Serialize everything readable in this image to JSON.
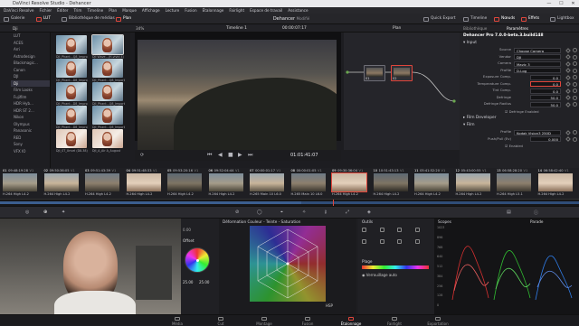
{
  "window": {
    "title": "DaVinci Resolve Studio - Dehancer",
    "controls": [
      "—",
      "☐",
      "✕"
    ]
  },
  "menu": [
    "DaVinci Resolve",
    "Fichier",
    "Éditer",
    "Trim",
    "Timeline",
    "Plan",
    "Marque",
    "Affichage",
    "Lecture",
    "Fusion",
    "Étalonnage",
    "Fairlight",
    "Espace de travail",
    "Assistance"
  ],
  "toolbar": {
    "left": [
      {
        "label": "Galerie",
        "icon": "gallery-icon"
      },
      {
        "label": "LUT",
        "icon": "lut-icon"
      },
      {
        "label": "Bibliothèque de médias",
        "icon": "media-library-icon"
      },
      {
        "label": "Plan",
        "icon": "clip-icon"
      }
    ],
    "project": "Dehancer",
    "project_status": "Modifié",
    "right": [
      {
        "label": "Quick Export",
        "icon": "export-icon"
      },
      {
        "label": "Timeline",
        "icon": "timeline-icon"
      },
      {
        "label": "Nœuds",
        "icon": "nodes-icon"
      },
      {
        "label": "Effets",
        "icon": "effects-icon"
      },
      {
        "label": "Lightbox",
        "icon": "lightbox-icon"
      }
    ]
  },
  "subbar": {
    "zoom": "34%",
    "timeline": "Timeline 1",
    "timecode": "00:00:07:17",
    "clip_label": "Plan",
    "insp_tab1": "Bibliothèque",
    "insp_tab2": "Paramètres"
  },
  "media_tree": {
    "header": "Dji",
    "items": [
      "LUT",
      "ACES",
      "Arri",
      "Astrodesign",
      "Blackmagic...",
      "Canon",
      "DJI",
      "Dji",
      "Film Looks",
      "Fujifilm",
      "HDR Hyb...",
      "HDR ST 2...",
      "Nikon",
      "Olympus",
      "Panasonic",
      "RED",
      "Sony",
      "VFX IO"
    ],
    "selected_index": 7
  },
  "lut_thumbs": [
    {
      "caption": "DJI_Phant...Q8_Impro"
    },
    {
      "caption": "DJI Wave...(H-vivid 4)"
    },
    {
      "caption": "DJI_Phant...D8_Impro"
    },
    {
      "caption": "DJI_Phant...Q8_Import"
    },
    {
      "caption": "DJI_Phant...D8_Impro"
    },
    {
      "caption": "DJI_Phant...Q8_Import"
    },
    {
      "caption": "DJI_Phant...D8_Impro"
    },
    {
      "caption": "DJI_Phant...Q8_Import"
    },
    {
      "caption": "DJI_ST_Unvel (D8.38)"
    },
    {
      "caption": "DJI_A_Air A_August"
    }
  ],
  "viewer": {
    "timecode": "01:01:41:07"
  },
  "node_graph": {
    "nodes": [
      {
        "label": "01"
      },
      {
        "label": "02"
      }
    ]
  },
  "inspector": {
    "plugin_title": "Dehancer Pro 7.0.0-beta.3.build148",
    "section_input": "Input",
    "rows": [
      {
        "label": "Source",
        "value": "Choose Camera"
      },
      {
        "label": "Vendor",
        "value": "DJI"
      },
      {
        "label": "Camera",
        "value": "Mavic 3"
      },
      {
        "label": "Profile",
        "value": "D-Log"
      },
      {
        "label": "Exposure Comp.",
        "value": "0.0"
      },
      {
        "label": "Temperature Comp.",
        "value": "0.0"
      },
      {
        "label": "Tint Comp.",
        "value": "0.0"
      },
      {
        "label": "Defringe",
        "value": "50.0"
      },
      {
        "label": "Defringe Radius",
        "value": "50.0"
      }
    ],
    "checkbox_defringe": "Defringe Enabled",
    "section_film_dev": "Film Developer",
    "section_film": "Film",
    "film_rows": [
      {
        "label": "Profile",
        "value": "Kodak Vision3 250D"
      },
      {
        "label": "Push/Pull (Ev)",
        "value": "0.000"
      }
    ],
    "enabled_label": "Enabled"
  },
  "clips": [
    {
      "num": "01",
      "tc": "09:48:19:28",
      "track": "V1",
      "caption": "H.264 High L4.2"
    },
    {
      "num": "02",
      "tc": "09:50:36:05",
      "track": "V1",
      "caption": "H.264 High L4.2"
    },
    {
      "num": "03",
      "tc": "09:51:43:39",
      "track": "V1",
      "caption": "H.264 High L4.2"
    },
    {
      "num": "04",
      "tc": "09:51:48:33",
      "track": "V1",
      "caption": "H.264 High L4.2"
    },
    {
      "num": "05",
      "tc": "09:53:20:16",
      "track": "V1",
      "caption": "H.264 High L4.2"
    },
    {
      "num": "06",
      "tc": "09:52:04:44",
      "track": "V1",
      "caption": "H.264 High L4.2"
    },
    {
      "num": "07",
      "tc": "00:00:01:17",
      "track": "V1",
      "caption": "H.265 Main 10 L6.0"
    },
    {
      "num": "08",
      "tc": "00:00:01:05",
      "track": "V1",
      "caption": "H.265 Main 10 L6.0"
    },
    {
      "num": "09",
      "tc": "09:30:36:04",
      "track": "V1",
      "caption": "H.264 High L4.2"
    },
    {
      "num": "10",
      "tc": "10:51:43:13",
      "track": "V1",
      "caption": "H.264 High L4.2"
    },
    {
      "num": "11",
      "tc": "05:41:52:20",
      "track": "V1",
      "caption": "H.264 High L4.2"
    },
    {
      "num": "12",
      "tc": "05:43:00:55",
      "track": "V1",
      "caption": "H.264 High L4.2"
    },
    {
      "num": "13",
      "tc": "06:58:28:20",
      "track": "V1",
      "caption": "H.264 High L5.1"
    },
    {
      "num": "14",
      "tc": "06:58:42:40",
      "track": "V1",
      "caption": "H.264 High L4.2"
    }
  ],
  "bottom": {
    "offset_label": "Offset",
    "offset_val1": "25.00",
    "offset_val2": "25.00",
    "zero_val": "0.00",
    "warp_title": "Déformation Couleur - Teinte - Saturation",
    "hsp_label": "HSP",
    "tools_title": "Outils",
    "range_title": "Plage",
    "lock_label": "Verrouillage auto",
    "scopes_title": "Scopes",
    "scopes_mode": "Parade",
    "scope_scale": [
      "1023",
      "896",
      "768",
      "640",
      "512",
      "384",
      "256",
      "128",
      "0"
    ]
  },
  "pages": [
    {
      "label": "Média",
      "icon": "media-page-icon"
    },
    {
      "label": "Cut",
      "icon": "cut-page-icon"
    },
    {
      "label": "Montage",
      "icon": "edit-page-icon"
    },
    {
      "label": "Fusion",
      "icon": "fusion-page-icon"
    },
    {
      "label": "Étalonnage",
      "icon": "color-page-icon"
    },
    {
      "label": "Fairlight",
      "icon": "fairlight-page-icon"
    },
    {
      "label": "Exportation",
      "icon": "deliver-page-icon"
    }
  ],
  "active_page_index": 4,
  "colors": {
    "accent": "#e0463c",
    "selection": "#4a86e8"
  }
}
